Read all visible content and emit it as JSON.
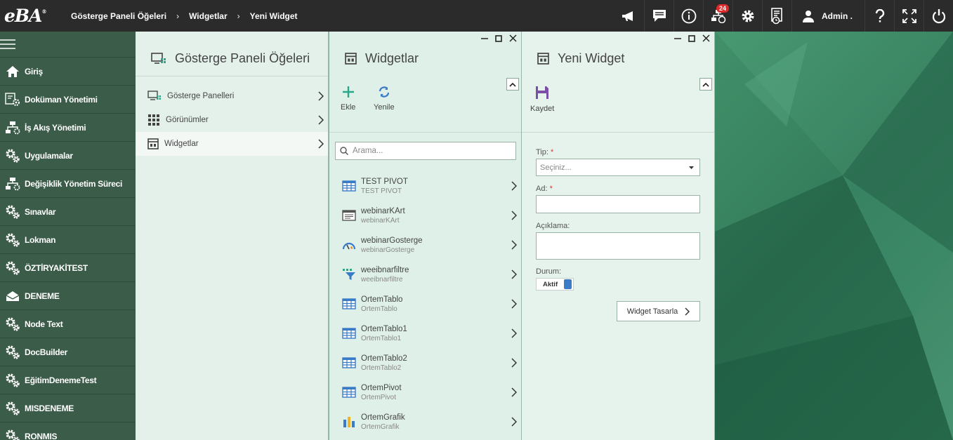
{
  "app": {
    "logo": "eBA",
    "logo_mark": "®"
  },
  "breadcrumb": [
    "Gösterge Paneli Öğeleri",
    "Widgetlar",
    "Yeni Widget"
  ],
  "breadcrumb_sep": "›",
  "topbar": {
    "notification_count": "24",
    "user_name": "Admin ."
  },
  "sidebar": {
    "items": [
      {
        "label": "Giriş",
        "icon": "home-icon"
      },
      {
        "label": "Doküman Yönetimi",
        "icon": "document-gear-icon"
      },
      {
        "label": "İş Akış Yönetimi",
        "icon": "workflow-icon"
      },
      {
        "label": "Uygulamalar",
        "icon": "gears-icon"
      },
      {
        "label": "Değişiklik Yönetim Süreci",
        "icon": "workflow-icon"
      },
      {
        "label": "Sınavlar",
        "icon": "gears-icon"
      },
      {
        "label": "Lokman",
        "icon": "gears-icon"
      },
      {
        "label": "ÖZTİRYAKİTEST",
        "icon": "gears-icon"
      },
      {
        "label": "DENEME",
        "icon": "envelope-icon"
      },
      {
        "label": "Node Text",
        "icon": "gears-icon"
      },
      {
        "label": "DocBuilder",
        "icon": "gears-icon"
      },
      {
        "label": "EğitimDenemeTest",
        "icon": "gears-icon"
      },
      {
        "label": "MISDENEME",
        "icon": "gears-icon"
      },
      {
        "label": "RONMIS",
        "icon": "gears-icon"
      }
    ]
  },
  "panel1": {
    "title": "Gösterge Paneli Öğeleri",
    "items": [
      {
        "label": "Gösterge Panelleri",
        "icon": "dashboard-icon"
      },
      {
        "label": "Görünümler",
        "icon": "grid-icon"
      },
      {
        "label": "Widgetlar",
        "icon": "widget-icon"
      }
    ]
  },
  "panel2": {
    "title": "Widgetlar",
    "add_label": "Ekle",
    "refresh_label": "Yenile",
    "search_placeholder": "Arama...",
    "items": [
      {
        "name": "TEST PIVOT",
        "sub": "TEST PIVOT",
        "icon": "table-icon"
      },
      {
        "name": "webinarKArt",
        "sub": "webinarKArt",
        "icon": "card-icon"
      },
      {
        "name": "webinarGosterge",
        "sub": "webinarGosterge",
        "icon": "gauge-icon"
      },
      {
        "name": "weeibnarfiltre",
        "sub": "weeibnarfiltre",
        "icon": "filter-icon"
      },
      {
        "name": "OrtemTablo",
        "sub": "OrtemTablo",
        "icon": "table-icon"
      },
      {
        "name": "OrtemTablo1",
        "sub": "OrtemTablo1",
        "icon": "table-icon"
      },
      {
        "name": "OrtemTablo2",
        "sub": "OrtemTablo2",
        "icon": "table-icon"
      },
      {
        "name": "OrtemPivot",
        "sub": "OrtemPivot",
        "icon": "table-icon"
      },
      {
        "name": "OrtemGrafik",
        "sub": "OrtemGrafik",
        "icon": "bar-chart-icon"
      }
    ]
  },
  "panel3": {
    "title": "Yeni Widget",
    "save_label": "Kaydet",
    "type_label": "Tip:",
    "type_placeholder": "Seçiniz...",
    "name_label": "Ad:",
    "desc_label": "Açıklama:",
    "status_label": "Durum:",
    "status_value": "Aktif",
    "design_button": "Widget Tasarla",
    "required_mark": "*"
  },
  "colors": {
    "topbar": "#2b2b2b",
    "sidebar": "#3a5c49",
    "accent_teal": "#2aa889",
    "accent_blue": "#3a7bc8",
    "save_purple": "#7b4ea8",
    "badge_red": "#e02a2a"
  }
}
